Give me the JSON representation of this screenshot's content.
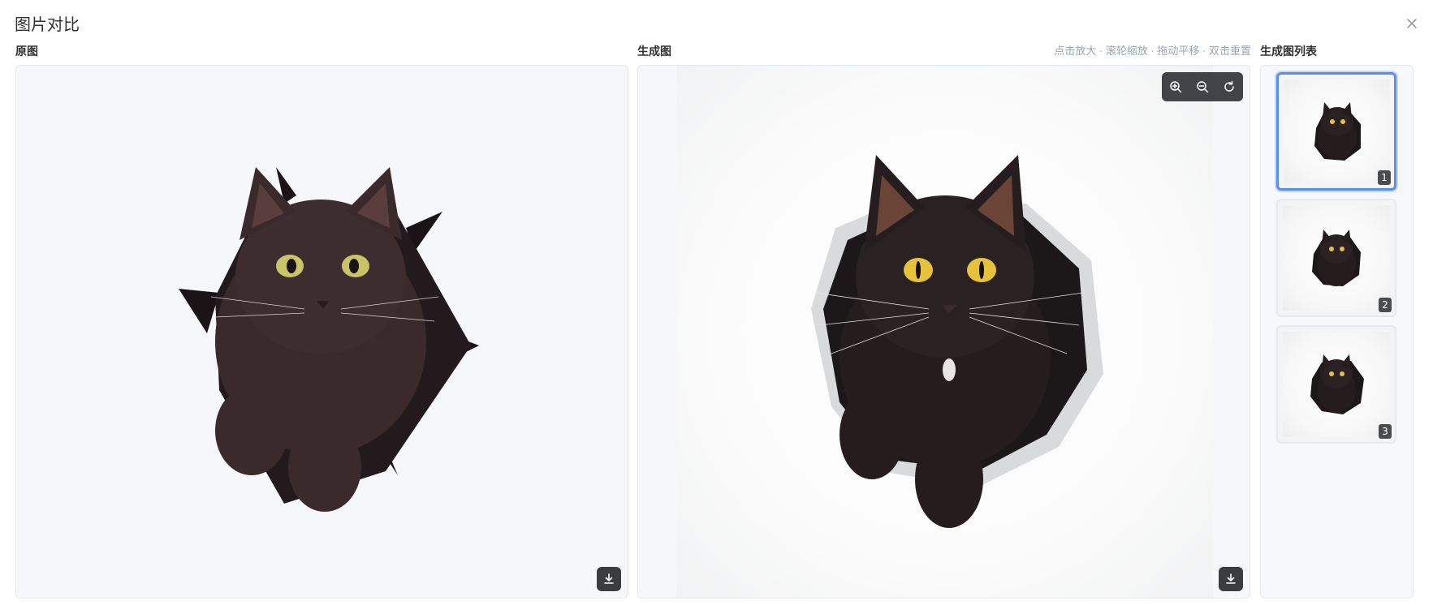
{
  "dialog": {
    "title": "图片对比"
  },
  "original": {
    "label": "原图"
  },
  "generated": {
    "label": "生成图",
    "hint": "点击放大 · 滚轮缩放 · 拖动平移 · 双击重置",
    "toolbar": {
      "zoom_in_icon": "zoom-in-icon",
      "zoom_out_icon": "zoom-out-icon",
      "reset_icon": "refresh-icon"
    }
  },
  "list": {
    "label": "生成图列表",
    "items": [
      {
        "number": "1",
        "selected": true
      },
      {
        "number": "2",
        "selected": false
      },
      {
        "number": "3",
        "selected": false
      }
    ]
  },
  "colors": {
    "accent": "#5b8def",
    "panel_bg": "#f5f7fb",
    "toolbar_bg": "#323438"
  }
}
